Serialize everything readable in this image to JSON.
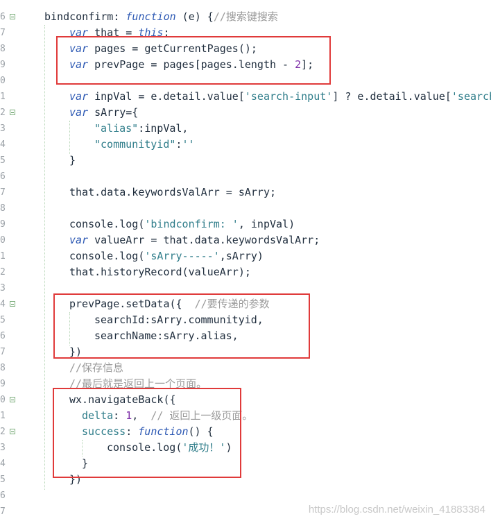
{
  "gutter_numbers": [
    "6",
    "7",
    "8",
    "9",
    "0",
    "1",
    "2",
    "3",
    "4",
    "5",
    "6",
    "7",
    "8",
    "9",
    "0",
    "1",
    "2",
    "3",
    "4",
    "5",
    "6",
    "7",
    "8",
    "9",
    "0",
    "1",
    "2",
    "3",
    "4",
    "5",
    "6",
    "7"
  ],
  "code": {
    "l1": [
      "bindconfirm",
      ": ",
      "function",
      " (e) {",
      "//搜索键搜索"
    ],
    "l2": [
      "var",
      " that = ",
      "this",
      ";"
    ],
    "l3": [
      "var",
      " pages = getCurrentPages();"
    ],
    "l4": [
      "var",
      " prevPage = pages[pages.length - ",
      "2",
      "];"
    ],
    "l6": [
      "var",
      " inpVal = e.detail.value[",
      "'search-input'",
      "] ? e.detail.value[",
      "'search"
    ],
    "l7": [
      "var",
      " sArry={"
    ],
    "l8": [
      "\"alias\"",
      ":inpVal,"
    ],
    "l9": [
      "\"communityid\"",
      ":",
      "''"
    ],
    "l10": [
      "}"
    ],
    "l12": [
      "that.data.keywordsValArr = sArry;"
    ],
    "l14": [
      "console.log(",
      "'bindconfirm: '",
      ", inpVal)"
    ],
    "l15": [
      "var",
      " valueArr = that.data.keywordsValArr;"
    ],
    "l16": [
      "console.log(",
      "'sArry-----'",
      ",sArry)"
    ],
    "l17": [
      "that.historyRecord(valueArr);"
    ],
    "l19": [
      "prevPage.setData({  ",
      "//要传递的参数"
    ],
    "l20": [
      "searchId",
      ":sArry.communityid,"
    ],
    "l21": [
      "searchName",
      ":sArry.alias,"
    ],
    "l22": [
      "})"
    ],
    "l23": [
      "//保存信息"
    ],
    "l24": [
      "//最后就是返回上一个页面。"
    ],
    "l25": [
      "wx.navigateBack({"
    ],
    "l26": [
      "delta",
      ": ",
      "1",
      ",  ",
      "// 返回上一级页面。"
    ],
    "l27": [
      "success",
      ": ",
      "function",
      "() {"
    ],
    "l28": [
      "console.log(",
      "'成功！'",
      ")"
    ],
    "l29": [
      "}"
    ],
    "l30": [
      "})"
    ]
  },
  "watermark": "https://blog.csdn.net/weixin_41883384",
  "colors": {
    "keyword": "#2c58b3",
    "string": "#2f7d8a",
    "comment": "#9a9a9a",
    "number": "#7d2ea8",
    "highlight": "#e03a3a"
  }
}
